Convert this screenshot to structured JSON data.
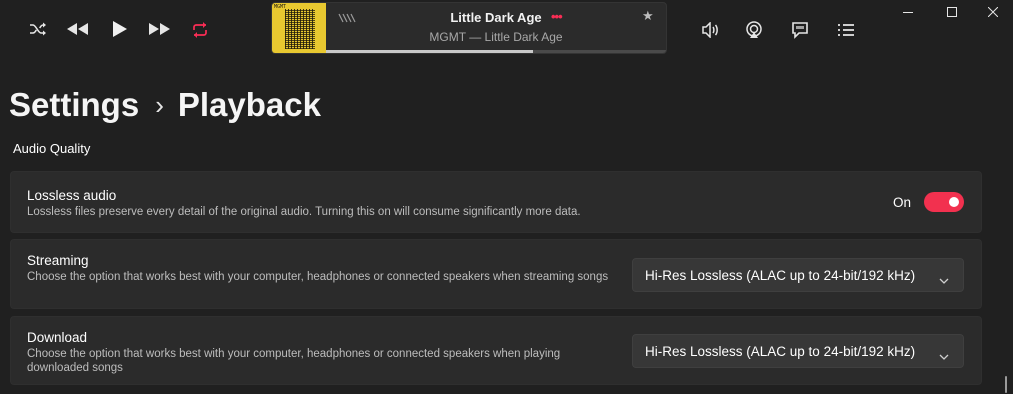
{
  "player": {
    "track_title": "Little Dark Age",
    "track_subtitle": "MGMT — Little Dark Age",
    "more_glyph": "•••",
    "star_glyph": "★",
    "progress_fraction": 0.61,
    "album_art_tag": "MGMT",
    "controls": [
      "shuffle-icon",
      "previous-icon",
      "play-icon",
      "next-icon",
      "repeat-icon"
    ],
    "right_controls": [
      "volume-icon",
      "airplay-icon",
      "lyrics-icon",
      "queue-icon"
    ],
    "accent_color": "#fa2d55"
  },
  "window": {
    "controls": [
      "minimize-icon",
      "maximize-icon",
      "close-icon"
    ]
  },
  "breadcrumb": {
    "parent": "Settings",
    "separator": "›",
    "current": "Playback"
  },
  "section": {
    "title": "Audio Quality"
  },
  "settings": {
    "lossless": {
      "title": "Lossless audio",
      "description": "Lossless files preserve every detail of the original audio. Turning this on will consume significantly more data.",
      "state_label": "On",
      "enabled": true
    },
    "streaming": {
      "title": "Streaming",
      "description": "Choose the option that works best with your computer, headphones or connected speakers when streaming songs",
      "selected": "Hi-Res Lossless (ALAC up to 24-bit/192 kHz)"
    },
    "download": {
      "title": "Download",
      "description": "Choose the option that works best with your computer, headphones or connected speakers when playing downloaded songs",
      "selected": "Hi-Res Lossless (ALAC up to 24-bit/192 kHz)"
    }
  }
}
